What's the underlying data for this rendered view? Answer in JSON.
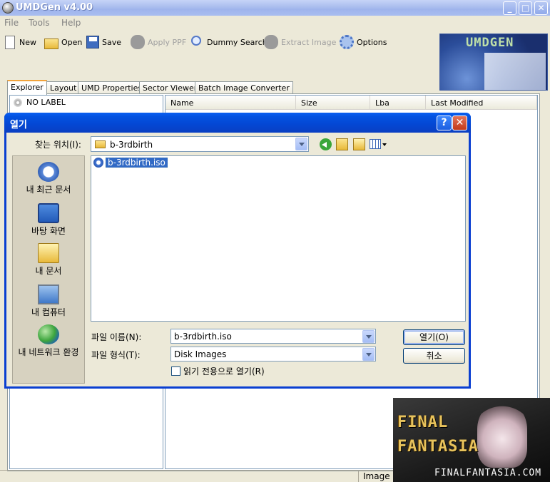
{
  "window": {
    "title": "UMDGen v4.00"
  },
  "menu": [
    {
      "label": "File"
    },
    {
      "label": "Tools"
    },
    {
      "label": "Help"
    }
  ],
  "toolbar": {
    "new": "New",
    "open": "Open",
    "save": "Save",
    "apply_ppf": "Apply PPF",
    "dummy_search": "Dummy Search",
    "extract_image": "Extract Image",
    "options": "Options"
  },
  "logo": {
    "text": "UMDGEN"
  },
  "tabs": [
    {
      "label": "Explorer",
      "active": true
    },
    {
      "label": "Layout"
    },
    {
      "label": "UMD Properties"
    },
    {
      "label": "Sector Viewer"
    },
    {
      "label": "Batch Image Converter"
    }
  ],
  "tree": {
    "root_label": "NO LABEL"
  },
  "list_columns": [
    "Name",
    "Size",
    "Lba",
    "Last Modified"
  ],
  "status": {
    "image_size": "Image Size: 0.04 MB"
  },
  "dialog": {
    "title": "열기",
    "help_glyph": "?",
    "close_glyph": "✕",
    "look_in_label": "찾는 위치(I):",
    "look_in_value": "b-3rdbirth",
    "places": [
      {
        "label": "내 최근 문서",
        "icon": "recent-documents-icon"
      },
      {
        "label": "바탕 화면",
        "icon": "desktop-icon"
      },
      {
        "label": "내 문서",
        "icon": "my-documents-icon"
      },
      {
        "label": "내 컴퓨터",
        "icon": "my-computer-icon"
      },
      {
        "label": "내 네트워크 환경",
        "icon": "network-places-icon"
      }
    ],
    "files": [
      {
        "name": "b-3rdbirth.iso",
        "selected": true
      }
    ],
    "filename_label": "파일 이름(N):",
    "filename_value": "b-3rdbirth.iso",
    "filetype_label": "파일 형식(T):",
    "filetype_value": "Disk Images",
    "open_button": "열기(O)",
    "cancel_button": "취소",
    "readonly_label": "읽기 전용으로 열기(R)",
    "readonly_checked": false
  },
  "watermark": {
    "line1": "FINAL",
    "line2": "FANTASIA",
    "url": "FINALFANTASIA.COM"
  },
  "colors": {
    "dialog_title_blue": "#0447d3",
    "selection_blue": "#316ac5",
    "xp_face": "#ece9d8"
  }
}
